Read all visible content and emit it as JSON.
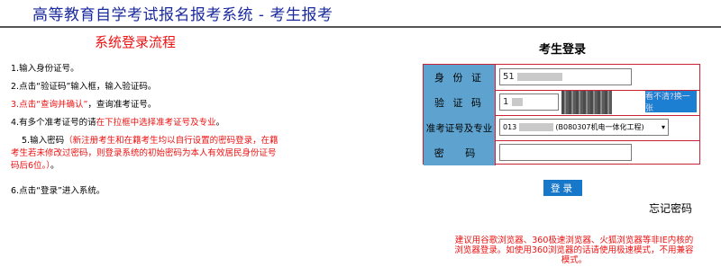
{
  "header": {
    "title": "高等教育自学考试报名报考系统 - 考生报考"
  },
  "flow": {
    "title": "系统登录流程",
    "step1": "1.输入身份证号。",
    "step2": "2.点击“验证码”输入框，输入验证码。",
    "step3_a": "3.点击“查询并确认”",
    "step3_b": "，查询准考证号。",
    "step4_a": "4.有多个准考证号的请",
    "step4_b": "在下拉框中选择准考证号及专业",
    "step4_c": "。",
    "step5_a": "5.输入密码",
    "step5_b": "（新注册考生和在籍考生均以自行设置的密码登录，在籍考生若未修改过密码，则登录系统的初始密码为本人有效居民身份证号码后6位。）",
    "step5_c": "。",
    "step6": "6.点击“登录”进入系统。"
  },
  "login": {
    "title": "考生登录",
    "id_label": "身 份 证",
    "id_value": "51",
    "captcha_label": "验 证 码",
    "captcha_value": "1",
    "captcha_button": "看不清?换一张",
    "exam_label": "准考证号及专业",
    "exam_selected_prefix": "013",
    "exam_selected_major": "(B080307机电一体化工程)",
    "password_label": "密 码",
    "login_button": "登录",
    "forgot_link": "忘记密码"
  },
  "notice": {
    "text": "建议用谷歌浏览器、360极速浏览器、火狐浏览器等非IE内核的浏览器登录。如使用360浏览器的话请使用极速模式，不用兼容模式。"
  }
}
